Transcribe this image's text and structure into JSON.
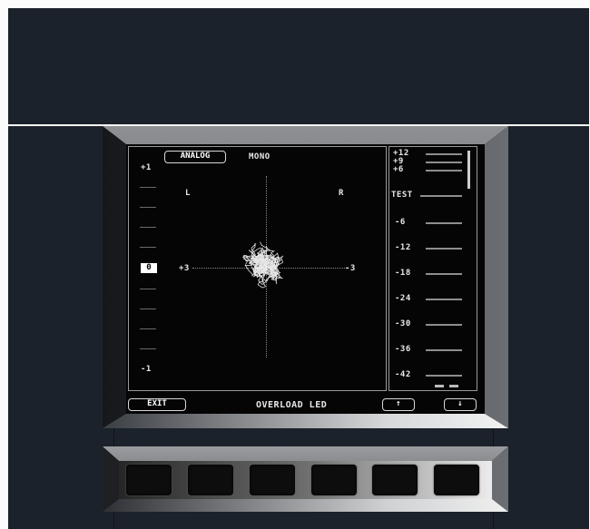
{
  "scope": {
    "source_button": "ANALOG",
    "mode_label": "MONO",
    "channel_left": "L",
    "channel_right": "R",
    "scale_top": "+1",
    "scale_center": "0",
    "scale_bottom": "-1",
    "axis_left": "+3",
    "axis_right": "-3"
  },
  "meter": {
    "labels": [
      "+12",
      "+9",
      "+6",
      "TEST",
      "-6",
      "-12",
      "-18",
      "-24",
      "-30",
      "-36",
      "-42"
    ]
  },
  "footer": {
    "exit_button": "EXIT",
    "status_label": "OVERLOAD LED",
    "up_button": "↑",
    "down_button": "↓"
  },
  "hardware_buttons": [
    "",
    "",
    "",
    "",
    "",
    ""
  ],
  "colors": {
    "background": "#1c222b",
    "screen": "#050505",
    "trace": "#ffffff"
  }
}
